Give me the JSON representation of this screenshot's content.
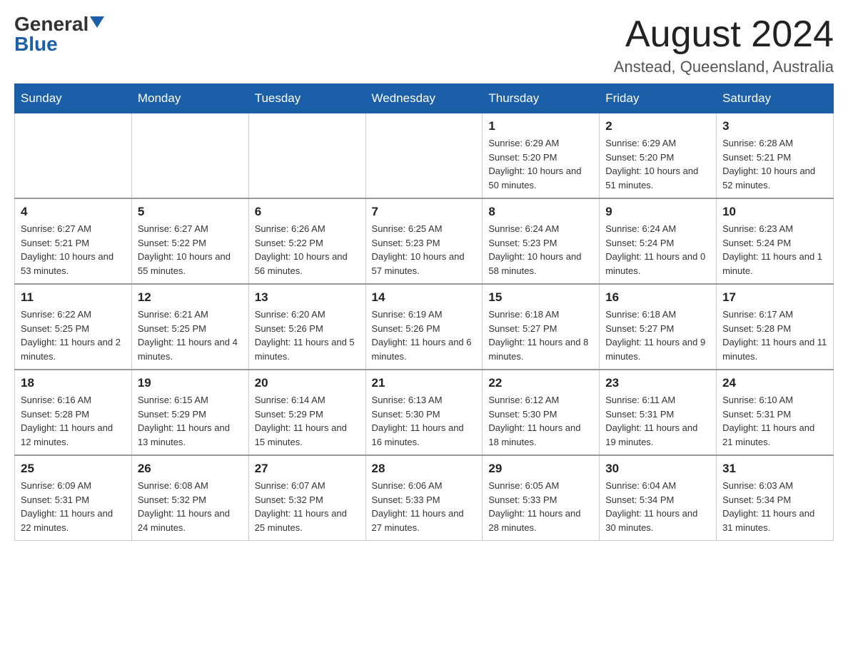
{
  "logo": {
    "general": "General",
    "blue": "Blue"
  },
  "title": "August 2024",
  "location": "Anstead, Queensland, Australia",
  "days_of_week": [
    "Sunday",
    "Monday",
    "Tuesday",
    "Wednesday",
    "Thursday",
    "Friday",
    "Saturday"
  ],
  "weeks": [
    [
      {
        "day": "",
        "info": ""
      },
      {
        "day": "",
        "info": ""
      },
      {
        "day": "",
        "info": ""
      },
      {
        "day": "",
        "info": ""
      },
      {
        "day": "1",
        "info": "Sunrise: 6:29 AM\nSunset: 5:20 PM\nDaylight: 10 hours and 50 minutes."
      },
      {
        "day": "2",
        "info": "Sunrise: 6:29 AM\nSunset: 5:20 PM\nDaylight: 10 hours and 51 minutes."
      },
      {
        "day": "3",
        "info": "Sunrise: 6:28 AM\nSunset: 5:21 PM\nDaylight: 10 hours and 52 minutes."
      }
    ],
    [
      {
        "day": "4",
        "info": "Sunrise: 6:27 AM\nSunset: 5:21 PM\nDaylight: 10 hours and 53 minutes."
      },
      {
        "day": "5",
        "info": "Sunrise: 6:27 AM\nSunset: 5:22 PM\nDaylight: 10 hours and 55 minutes."
      },
      {
        "day": "6",
        "info": "Sunrise: 6:26 AM\nSunset: 5:22 PM\nDaylight: 10 hours and 56 minutes."
      },
      {
        "day": "7",
        "info": "Sunrise: 6:25 AM\nSunset: 5:23 PM\nDaylight: 10 hours and 57 minutes."
      },
      {
        "day": "8",
        "info": "Sunrise: 6:24 AM\nSunset: 5:23 PM\nDaylight: 10 hours and 58 minutes."
      },
      {
        "day": "9",
        "info": "Sunrise: 6:24 AM\nSunset: 5:24 PM\nDaylight: 11 hours and 0 minutes."
      },
      {
        "day": "10",
        "info": "Sunrise: 6:23 AM\nSunset: 5:24 PM\nDaylight: 11 hours and 1 minute."
      }
    ],
    [
      {
        "day": "11",
        "info": "Sunrise: 6:22 AM\nSunset: 5:25 PM\nDaylight: 11 hours and 2 minutes."
      },
      {
        "day": "12",
        "info": "Sunrise: 6:21 AM\nSunset: 5:25 PM\nDaylight: 11 hours and 4 minutes."
      },
      {
        "day": "13",
        "info": "Sunrise: 6:20 AM\nSunset: 5:26 PM\nDaylight: 11 hours and 5 minutes."
      },
      {
        "day": "14",
        "info": "Sunrise: 6:19 AM\nSunset: 5:26 PM\nDaylight: 11 hours and 6 minutes."
      },
      {
        "day": "15",
        "info": "Sunrise: 6:18 AM\nSunset: 5:27 PM\nDaylight: 11 hours and 8 minutes."
      },
      {
        "day": "16",
        "info": "Sunrise: 6:18 AM\nSunset: 5:27 PM\nDaylight: 11 hours and 9 minutes."
      },
      {
        "day": "17",
        "info": "Sunrise: 6:17 AM\nSunset: 5:28 PM\nDaylight: 11 hours and 11 minutes."
      }
    ],
    [
      {
        "day": "18",
        "info": "Sunrise: 6:16 AM\nSunset: 5:28 PM\nDaylight: 11 hours and 12 minutes."
      },
      {
        "day": "19",
        "info": "Sunrise: 6:15 AM\nSunset: 5:29 PM\nDaylight: 11 hours and 13 minutes."
      },
      {
        "day": "20",
        "info": "Sunrise: 6:14 AM\nSunset: 5:29 PM\nDaylight: 11 hours and 15 minutes."
      },
      {
        "day": "21",
        "info": "Sunrise: 6:13 AM\nSunset: 5:30 PM\nDaylight: 11 hours and 16 minutes."
      },
      {
        "day": "22",
        "info": "Sunrise: 6:12 AM\nSunset: 5:30 PM\nDaylight: 11 hours and 18 minutes."
      },
      {
        "day": "23",
        "info": "Sunrise: 6:11 AM\nSunset: 5:31 PM\nDaylight: 11 hours and 19 minutes."
      },
      {
        "day": "24",
        "info": "Sunrise: 6:10 AM\nSunset: 5:31 PM\nDaylight: 11 hours and 21 minutes."
      }
    ],
    [
      {
        "day": "25",
        "info": "Sunrise: 6:09 AM\nSunset: 5:31 PM\nDaylight: 11 hours and 22 minutes."
      },
      {
        "day": "26",
        "info": "Sunrise: 6:08 AM\nSunset: 5:32 PM\nDaylight: 11 hours and 24 minutes."
      },
      {
        "day": "27",
        "info": "Sunrise: 6:07 AM\nSunset: 5:32 PM\nDaylight: 11 hours and 25 minutes."
      },
      {
        "day": "28",
        "info": "Sunrise: 6:06 AM\nSunset: 5:33 PM\nDaylight: 11 hours and 27 minutes."
      },
      {
        "day": "29",
        "info": "Sunrise: 6:05 AM\nSunset: 5:33 PM\nDaylight: 11 hours and 28 minutes."
      },
      {
        "day": "30",
        "info": "Sunrise: 6:04 AM\nSunset: 5:34 PM\nDaylight: 11 hours and 30 minutes."
      },
      {
        "day": "31",
        "info": "Sunrise: 6:03 AM\nSunset: 5:34 PM\nDaylight: 11 hours and 31 minutes."
      }
    ]
  ]
}
